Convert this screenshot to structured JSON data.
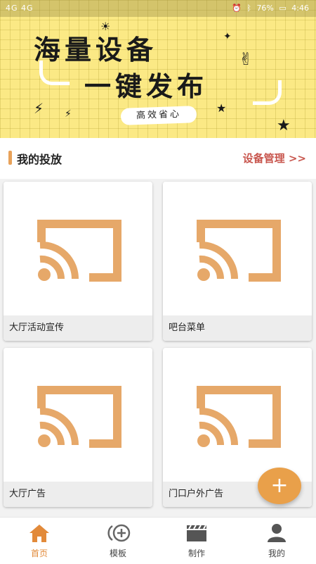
{
  "status_bar": {
    "left": "4G 4G",
    "battery": "76%",
    "time": "4:46"
  },
  "banner": {
    "line1": "海量设备",
    "line2": "一键发布",
    "tagline": "高效省心"
  },
  "section": {
    "title": "我的投放",
    "link": "设备管理 >>"
  },
  "cards": [
    {
      "label": "大厅活动宣传"
    },
    {
      "label": "吧台菜单"
    },
    {
      "label": "大厅广告"
    },
    {
      "label": "门口户外广告"
    }
  ],
  "fab": {
    "label": "+"
  },
  "nav": {
    "items": [
      {
        "label": "首页",
        "icon": "home-icon",
        "active": true
      },
      {
        "label": "模板",
        "icon": "template-icon"
      },
      {
        "label": "制作",
        "icon": "clapperboard-icon"
      },
      {
        "label": "我的",
        "icon": "user-icon"
      }
    ]
  },
  "colors": {
    "accent": "#e9a04a",
    "link": "#c8564e",
    "banner_bg": "#fbe985",
    "cast_icon": "#e6a869"
  }
}
